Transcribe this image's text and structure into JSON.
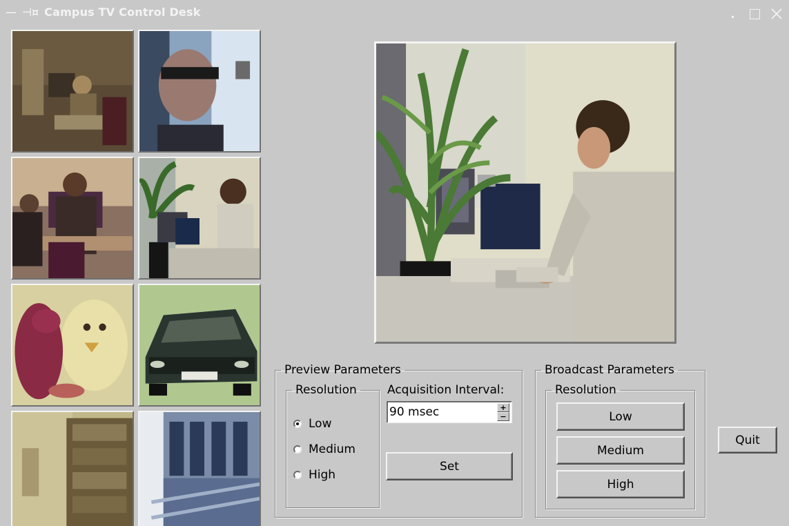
{
  "window": {
    "title": "Campus TV Control Desk",
    "menu_glyph": "—",
    "pin_glyph": "⊣¤"
  },
  "colors": {
    "background": "#c8c8c8",
    "title_text": "#f4f4f4",
    "input_bg": "#ffffff"
  },
  "camera_thumbnails": [
    {
      "scene": "office-room-dim"
    },
    {
      "scene": "person-with-glasses"
    },
    {
      "scene": "people-at-desks"
    },
    {
      "scene": "man-at-computer-with-plant"
    },
    {
      "scene": "stuffed-toys"
    },
    {
      "scene": "model-car"
    },
    {
      "scene": "bookshelf-room"
    },
    {
      "scene": "building-windows"
    }
  ],
  "preview_scene": "man-at-computer-with-plant",
  "preview_parameters": {
    "title": "Preview Parameters",
    "resolution_title": "Resolution",
    "resolution_options": [
      "Low",
      "Medium",
      "High"
    ],
    "selected_resolution": "Low",
    "acquisition_label": "Acquisition Interval:",
    "acquisition_value": "90 msec",
    "spin_up": "+",
    "spin_down": "−",
    "set_label": "Set"
  },
  "broadcast_parameters": {
    "title": "Broadcast Parameters",
    "resolution_title": "Resolution",
    "buttons": [
      "Low",
      "Medium",
      "High"
    ]
  },
  "quit_label": "Quit"
}
